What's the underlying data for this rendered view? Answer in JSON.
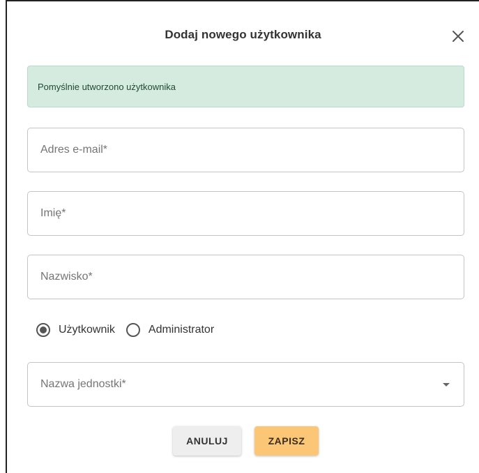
{
  "dialog": {
    "title": "Dodaj nowego użytkownika",
    "close_icon": "close-icon"
  },
  "alert": {
    "message": "Pomyślnie utworzono użytkownika",
    "type": "success",
    "background": "#d6ebdf"
  },
  "form": {
    "email": {
      "placeholder": "Adres e-mail*",
      "value": ""
    },
    "first_name": {
      "placeholder": "Imię*",
      "value": ""
    },
    "last_name": {
      "placeholder": "Nazwisko*",
      "value": ""
    },
    "role": {
      "options": [
        {
          "label": "Użytkownik",
          "checked": true
        },
        {
          "label": "Administrator",
          "checked": false
        }
      ]
    },
    "unit": {
      "label": "Nazwa jednostki*",
      "icon": "dropdown-caret-icon"
    }
  },
  "actions": {
    "cancel_label": "ANULUJ",
    "save_label": "ZAPISZ",
    "save_color": "#fcc677"
  }
}
